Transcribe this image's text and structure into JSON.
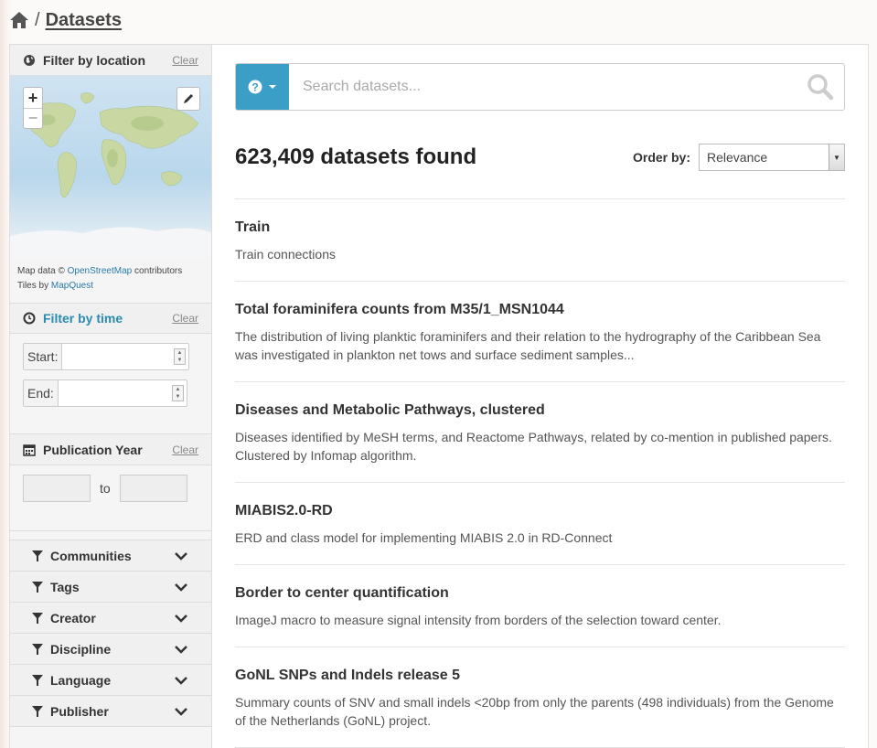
{
  "breadcrumb": {
    "separator": "/",
    "title": "Datasets"
  },
  "filters": {
    "location": {
      "title": "Filter by location",
      "clear": "Clear"
    },
    "map": {
      "zoom_in": "+",
      "zoom_out": "−",
      "attribution_prefix": "Map data ©",
      "osm_link": "OpenStreetMap",
      "attribution_suffix": "contributors",
      "tiles_prefix": "Tiles by",
      "mapquest_link": "MapQuest"
    },
    "time": {
      "title": "Filter by time",
      "clear": "Clear",
      "start_label": "Start:",
      "end_label": "End:"
    },
    "year": {
      "title": "Publication Year",
      "clear": "Clear",
      "to_label": "to"
    },
    "facets": [
      {
        "label": "Communities"
      },
      {
        "label": "Tags"
      },
      {
        "label": "Creator"
      },
      {
        "label": "Discipline"
      },
      {
        "label": "Language"
      },
      {
        "label": "Publisher"
      }
    ]
  },
  "search": {
    "placeholder": "Search datasets..."
  },
  "results": {
    "count_text": "623,409 datasets found",
    "order_label": "Order by:",
    "order_value": "Relevance",
    "items": [
      {
        "title": "Train",
        "description": "Train connections"
      },
      {
        "title": "Total foraminifera counts from M35/1_MSN1044",
        "description": "The distribution of living planktic foraminifers and their relation to the hydrography of the Caribbean Sea was investigated in plankton net tows and surface sediment samples..."
      },
      {
        "title": "Diseases and Metabolic Pathways, clustered",
        "description": "Diseases identified by MeSH terms, and Reactome Pathways, related by co-mention in published papers. Clustered by Infomap algorithm."
      },
      {
        "title": "MIABIS2.0-RD",
        "description": "ERD and class model for implementing MIABIS 2.0 in RD-Connect"
      },
      {
        "title": "Border to center quantification",
        "description": "ImageJ macro to measure signal intensity from borders of the selection toward center."
      },
      {
        "title": "GoNL SNPs and Indels release 5",
        "description": "Summary counts of SNV and small indels <20bp from only the parents (498 individuals) from the Genome of the Netherlands (GoNL) project."
      }
    ]
  }
}
